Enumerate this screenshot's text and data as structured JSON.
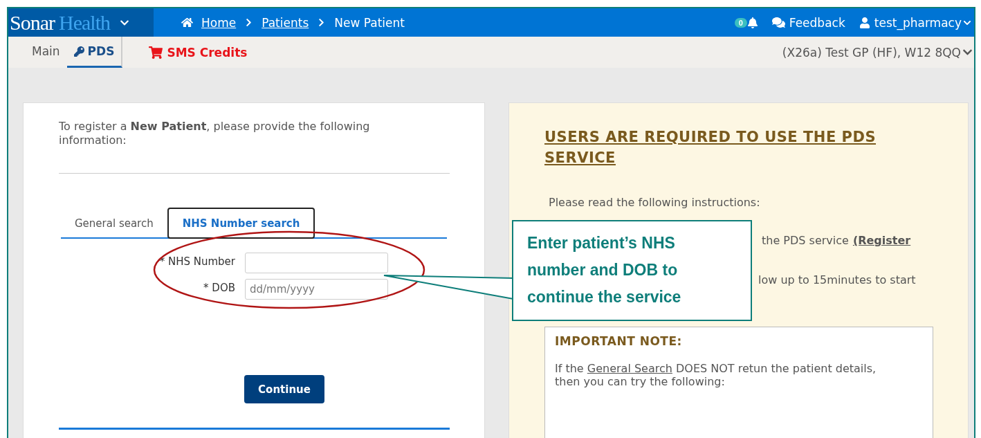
{
  "header": {
    "logo": [
      {
        "text": "Sonar",
        "kind": "primary"
      },
      {
        "text": "Health",
        "kind": "accent"
      }
    ],
    "breadcrumbs": [
      {
        "label": "Home",
        "link": true,
        "kind": "home"
      },
      {
        "label": "Patients",
        "link": true,
        "kind": "plain"
      },
      {
        "label": "New Patient",
        "link": false,
        "kind": "plain"
      }
    ],
    "notifications": {
      "count": "0"
    },
    "feedback": "Feedback",
    "user": "test_pharmacy"
  },
  "subnav": {
    "tabs": [
      {
        "label": "Main",
        "selected": false,
        "kind": "plain"
      },
      {
        "label": "PDS",
        "selected": true,
        "kind": "key"
      }
    ],
    "sms": "SMS Credits",
    "practice": "(X26a) Test GP (HF), W12 8QQ"
  },
  "form": {
    "intro": "To register a **New Patient**, please provide the following information:",
    "tabs": [
      {
        "label": "General search",
        "selected": false
      },
      {
        "label": "NHS Number search",
        "selected": true
      }
    ],
    "fields": [
      {
        "label": "* NHS Number"
      },
      {
        "label": "* DOB",
        "placeholder": "dd/mm/yyyy"
      }
    ],
    "button": "Continue"
  },
  "notice": {
    "title": "USERS ARE REQUIRED TO USE THE PDS SERVICE",
    "intro": "Please read the following instructions:",
    "lines": [
      {
        "text": "the PDS service",
        "link": "(Register"
      },
      {
        "text": "low up to 15minutes to start"
      }
    ],
    "note": {
      "title": "IMPORTANT NOTE:",
      "before": "If the",
      "link": "General Search",
      "after": "DOES NOT retun the patient details, then you can try the following:"
    }
  },
  "callout": {
    "text": "Enter patient’s NHS number and DOB to continue the service"
  }
}
